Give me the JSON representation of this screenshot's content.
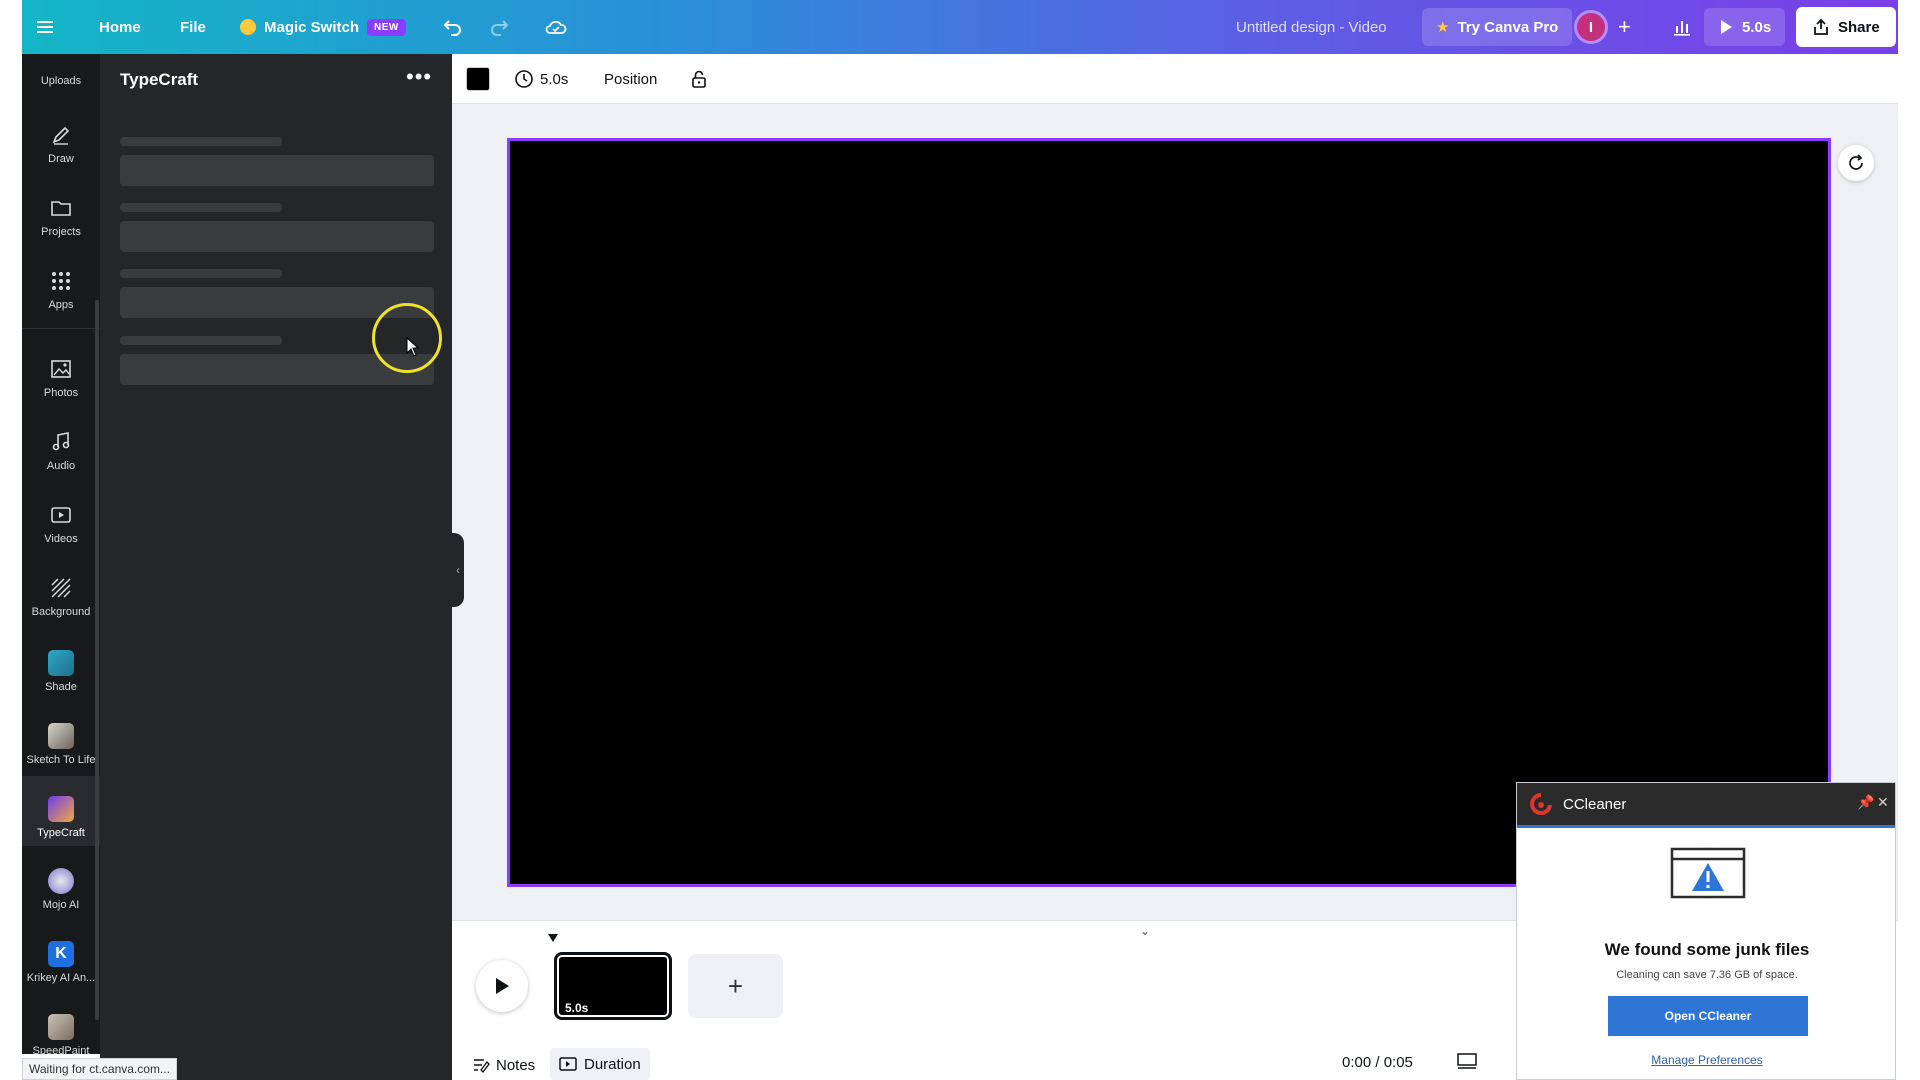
{
  "topbar": {
    "home": "Home",
    "file": "File",
    "magic_switch": "Magic Switch",
    "new_badge": "NEW",
    "design_title": "Untitled design - Video",
    "try_pro": "Try Canva Pro",
    "avatar_letter": "I",
    "play_duration": "5.0s",
    "share": "Share"
  },
  "rail": {
    "items": [
      {
        "label": "Uploads"
      },
      {
        "label": "Draw"
      },
      {
        "label": "Projects"
      },
      {
        "label": "Apps"
      },
      {
        "label": "Photos"
      },
      {
        "label": "Audio"
      },
      {
        "label": "Videos"
      },
      {
        "label": "Background"
      },
      {
        "label": "Shade"
      },
      {
        "label": "Sketch To Life"
      },
      {
        "label": "TypeCraft"
      },
      {
        "label": "Mojo AI"
      },
      {
        "label": "Krikey AI An..."
      },
      {
        "label": "SpeedPaint"
      }
    ]
  },
  "panel": {
    "title": "TypeCraft",
    "more": "•••"
  },
  "toolbar": {
    "duration": "5.0s",
    "position": "Position"
  },
  "timeline": {
    "clip_duration": "5.0s",
    "notes": "Notes",
    "duration": "Duration",
    "time": "0:00 / 0:05"
  },
  "status_bar": "Waiting for ct.canva.com...",
  "ccleaner": {
    "title": "CCleaner",
    "heading": "We found some junk files",
    "subtext": "Cleaning can save 7.36 GB of space.",
    "button": "Open CCleaner",
    "link": "Manage Preferences"
  },
  "colors": {
    "accent": "#8b3dff",
    "cc_blue": "#2e75d6",
    "panel_bg": "#252627",
    "rail_bg": "#18191b"
  }
}
